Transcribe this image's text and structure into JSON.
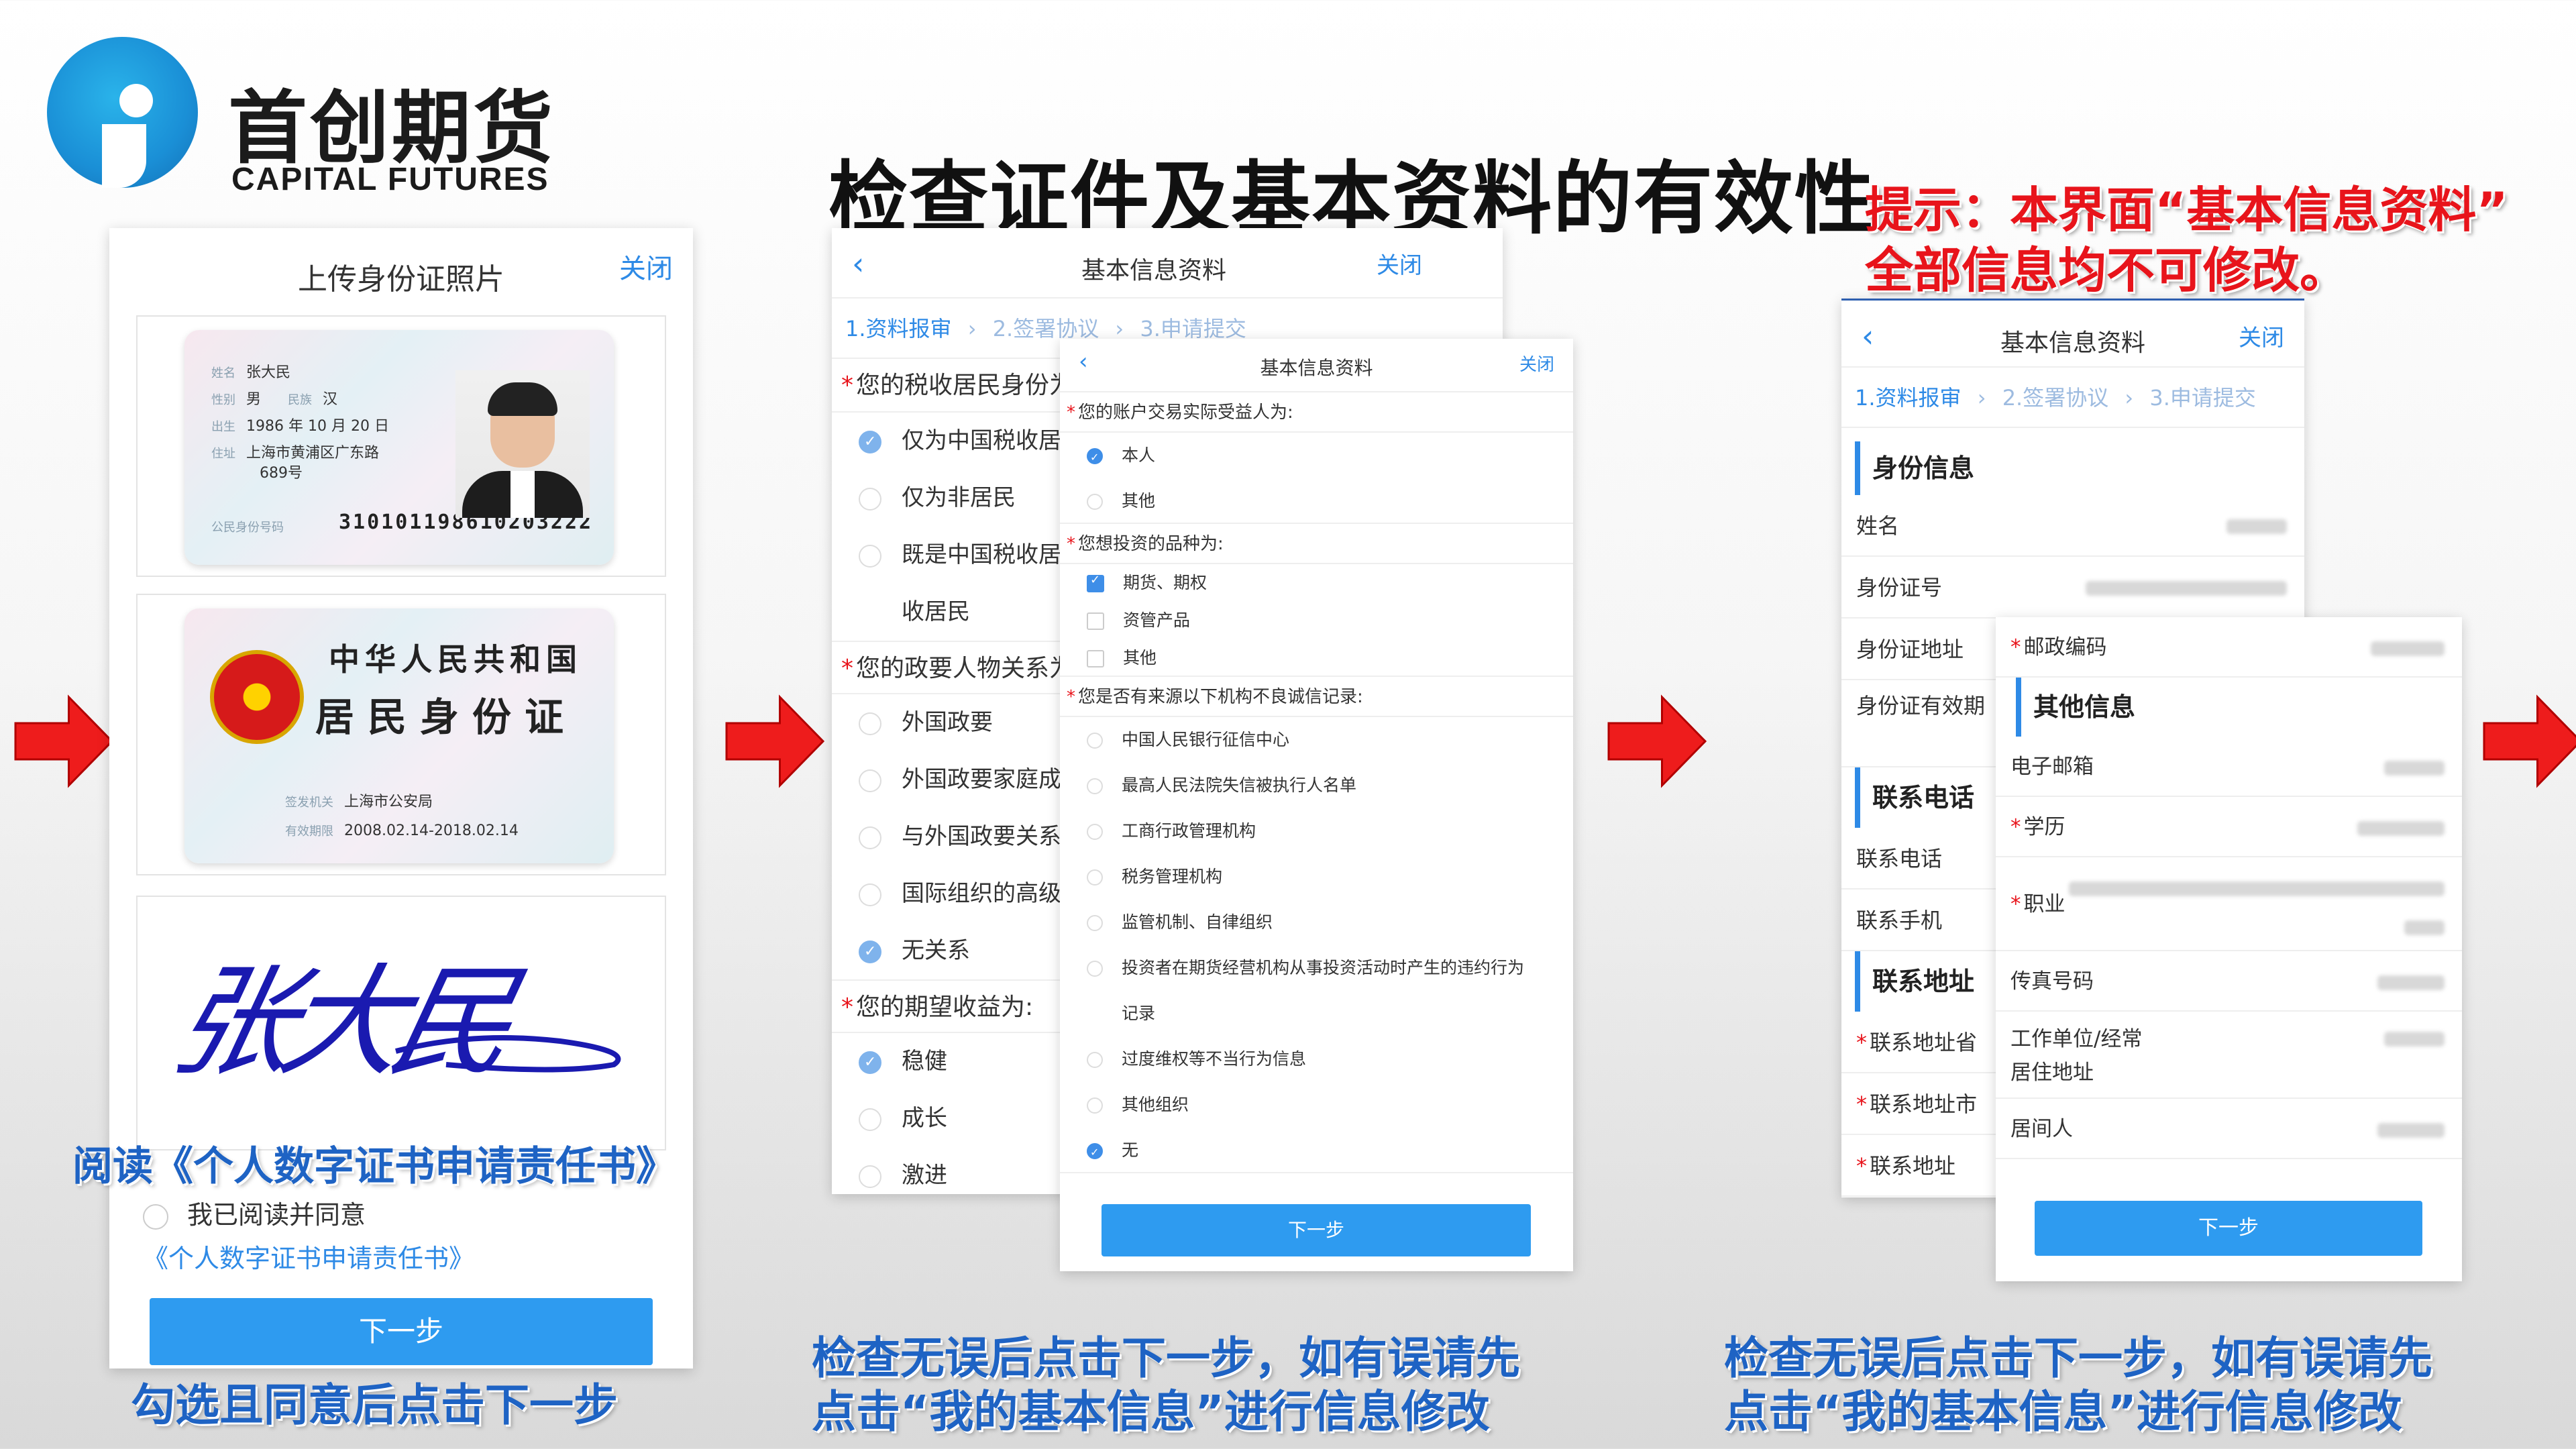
{
  "brand": {
    "name_cn": "首创期货",
    "name_en": "CAPITAL FUTURES",
    "accent": "#1a8fd6"
  },
  "title": "检查证件及基本资料的有效性",
  "tip": [
    "提示：本界面“基本信息资料”",
    "全部信息均不可修改。"
  ],
  "captions": {
    "step1": "勾选且同意后点击下一步",
    "step2": [
      "检查无误后点击下一步，如有误请先",
      "点击“我的基本信息”进行信息修改"
    ],
    "step3": [
      "检查无误后点击下一步，如有误请先",
      "点击“我的基本信息”进行信息修改"
    ]
  },
  "panel1": {
    "title": "上传身份证照片",
    "close": "关闭",
    "id_front": {
      "name": "张大民",
      "sex": "男",
      "ethnic": "汉",
      "birth": "1986 年 10 月 20 日",
      "address_1": "上海市黄浦区广东路",
      "address_2": "689号",
      "label_name": "姓名",
      "label_sex": "性别",
      "label_ethnic": "民族",
      "label_birth": "出生",
      "label_address": "住址",
      "label_number": "公民身份号码",
      "number": "310101198610203222"
    },
    "id_back": {
      "title_1": "中华人民共和国",
      "title_2": "居民身份证",
      "label_authority": "签发机关",
      "authority": "上海市公安局",
      "label_valid": "有效期限",
      "valid": "2008.02.14-2018.02.14"
    },
    "signature": "张大民",
    "read_banner": "阅读《个人数字证书申请责任书》",
    "agree_text": "我已阅读并同意",
    "agree_link": "《个人数字证书申请责任书》",
    "next": "下一步"
  },
  "panel2": {
    "back": "‹",
    "title": "基本信息资料",
    "close": "关闭",
    "steps": [
      "1.资料报审",
      "›",
      "2.签署协议",
      "›",
      "3.申请提交"
    ],
    "q_tax": "您的税收居民身份为",
    "tax_options": [
      "仅为中国税收居民",
      "仅为非居民",
      "既是中国税收居民",
      "收居民"
    ],
    "q_pep": "您的政要人物关系为",
    "pep_options": [
      "外国政要",
      "外国政要家庭成员",
      "与外国政要关系密",
      "国际组织的高级管",
      "无关系"
    ],
    "q_return": "您的期望收益为:",
    "return_options": [
      "稳健",
      "成长",
      "激进"
    ]
  },
  "panel2_front": {
    "back": "‹",
    "title": "基本信息资料",
    "close": "关闭",
    "q_beneficiary": "您的账户交易实际受益人为:",
    "beneficiary_options": [
      "本人",
      "其他"
    ],
    "q_products": "您想投资的品种为:",
    "product_options": [
      "期货、期权",
      "资管产品",
      "其他"
    ],
    "q_credit": "您是否有来源以下机构不良诚信记录:",
    "credit_options": [
      "中国人民银行征信中心",
      "最高人民法院失信被执行人名单",
      "工商行政管理机构",
      "税务管理机构",
      "监管机制、自律组织",
      "投资者在期货经营机构从事投资活动时产生的违约行为",
      "记录",
      "过度维权等不当行为信息",
      "其他组织",
      "无"
    ],
    "next": "下一步"
  },
  "panel3": {
    "back": "‹",
    "title": "基本信息资料",
    "close": "关闭",
    "steps": [
      "1.资料报审",
      "›",
      "2.签署协议",
      "›",
      "3.申请提交"
    ],
    "sec_identity": "身份信息",
    "name": "姓名",
    "id_number": "身份证号",
    "id_address": "身份证地址",
    "id_valid": "身份证有效期",
    "sec_phone": "联系电话",
    "phone": "联系电话",
    "mobile": "联系手机",
    "sec_address": "联系地址",
    "province": "联系地址省",
    "city": "联系地址市",
    "address": "联系地址"
  },
  "panel3_front": {
    "postcode": "邮政编码",
    "sec_other": "其他信息",
    "email": "电子邮箱",
    "education": "学历",
    "occupation": "职业",
    "fax": "传真号码",
    "work_1": "工作单位/经常",
    "work_2": "居住地址",
    "intermediary": "居间人",
    "next": "下一步"
  },
  "colors": {
    "arrow": "#ee1c1c",
    "primary_button": "#2e9bf0",
    "tip": "#e8141b",
    "caption": "#1e63c4"
  }
}
